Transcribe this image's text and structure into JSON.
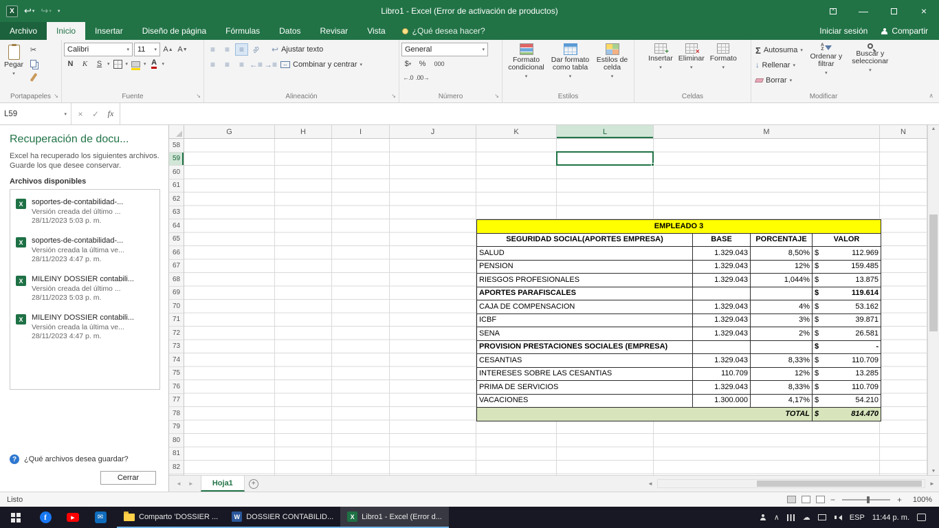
{
  "titlebar": {
    "title": "Libro1 - Excel (Error de activación de productos)"
  },
  "ribbon": {
    "tabs": [
      {
        "label": "Archivo",
        "active": false,
        "file": true
      },
      {
        "label": "Inicio",
        "active": true
      },
      {
        "label": "Insertar"
      },
      {
        "label": "Diseño de página"
      },
      {
        "label": "Fórmulas"
      },
      {
        "label": "Datos"
      },
      {
        "label": "Revisar"
      },
      {
        "label": "Vista"
      }
    ],
    "tell_me": "¿Qué desea hacer?",
    "sign_in": "Iniciar sesión",
    "share": "Compartir",
    "clipboard": {
      "label": "Portapapeles",
      "paste": "Pegar"
    },
    "font": {
      "label": "Fuente",
      "name": "Calibri",
      "size": "11",
      "bold": "N",
      "italic": "K",
      "underline": "S"
    },
    "alignment": {
      "label": "Alineación",
      "wrap": "Ajustar texto",
      "merge": "Combinar y centrar"
    },
    "number": {
      "label": "Número",
      "format": "General",
      "currency": "$",
      "percent": "%",
      "thousands": "000",
      "inc_dec": "←.0",
      "dec_dec": ".00→"
    },
    "styles": {
      "label": "Estilos",
      "conditional": "Formato condicional",
      "as_table": "Dar formato como tabla",
      "cell_styles": "Estilos de celda"
    },
    "cells": {
      "label": "Celdas",
      "insert": "Insertar",
      "delete": "Eliminar",
      "format": "Formato"
    },
    "editing": {
      "label": "Modificar",
      "autosum": "Autosuma",
      "fill": "Rellenar",
      "clear": "Borrar",
      "sort": "Ordenar y filtrar",
      "find": "Buscar y seleccionar"
    }
  },
  "formula_bar": {
    "name_box": "L59",
    "formula": ""
  },
  "recovery": {
    "title": "Recuperación de docu...",
    "description": "Excel ha recuperado los siguientes archivos. Guarde los que desee conservar.",
    "available": "Archivos disponibles",
    "files": [
      {
        "name": "soportes-de-contabilidad-...",
        "version": "Versión creada del último ...",
        "date": "28/11/2023 5:03 p. m."
      },
      {
        "name": "soportes-de-contabilidad-...",
        "version": "Versión creada la última ve...",
        "date": "28/11/2023 4:47 p. m."
      },
      {
        "name": "MILEINY DOSSIER contabili...",
        "version": "Versión creada del último ...",
        "date": "28/11/2023 5:03 p. m."
      },
      {
        "name": "MILEINY DOSSIER contabili...",
        "version": "Versión creada la última ve...",
        "date": "28/11/2023 4:47 p. m."
      }
    ],
    "question": "¿Qué archivos desea guardar?",
    "close": "Cerrar"
  },
  "sheet": {
    "columns": [
      "G",
      "H",
      "I",
      "J",
      "K",
      "L",
      "M",
      "N"
    ],
    "selected_column": "L",
    "row_numbers": [
      58,
      59,
      60,
      61,
      62,
      63,
      64,
      65,
      66,
      67,
      68,
      69,
      70,
      71,
      72,
      73,
      74,
      75,
      76,
      77,
      78,
      79,
      80,
      81,
      82
    ],
    "selected_row": 59,
    "table": {
      "title": "EMPLEADO 3",
      "headers": [
        "SEGURIDAD SOCIAL(APORTES EMPRESA)",
        "BASE",
        "PORCENTAJE",
        "VALOR"
      ],
      "rows": [
        {
          "label": "SALUD",
          "base": "1.329.043",
          "pct": "8,50%",
          "cur": "$",
          "val": "112.969",
          "bold": false
        },
        {
          "label": "PENSION",
          "base": "1.329.043",
          "pct": "12%",
          "cur": "$",
          "val": "159.485",
          "bold": false
        },
        {
          "label": "RIESGOS PROFESIONALES",
          "base": "1.329.043",
          "pct": "1,044%",
          "cur": "$",
          "val": "13.875",
          "bold": false
        },
        {
          "label": "APORTES PARAFISCALES",
          "base": "",
          "pct": "",
          "cur": "$",
          "val": "119.614",
          "bold": true
        },
        {
          "label": "CAJA DE COMPENSACION",
          "base": "1.329.043",
          "pct": "4%",
          "cur": "$",
          "val": "53.162",
          "bold": false
        },
        {
          "label": "ICBF",
          "base": "1.329.043",
          "pct": "3%",
          "cur": "$",
          "val": "39.871",
          "bold": false
        },
        {
          "label": "SENA",
          "base": "1.329.043",
          "pct": "2%",
          "cur": "$",
          "val": "26.581",
          "bold": false
        },
        {
          "label": "PROVISION PRESTACIONES SOCIALES (EMPRESA)",
          "base": "",
          "pct": "",
          "cur": "$",
          "val": "-",
          "bold": true
        },
        {
          "label": "CESANTIAS",
          "base": "1.329.043",
          "pct": "8,33%",
          "cur": "$",
          "val": "110.709",
          "bold": false
        },
        {
          "label": "INTERESES SOBRE LAS CESANTIAS",
          "base": "110.709",
          "pct": "12%",
          "cur": "$",
          "val": "13.285",
          "bold": false
        },
        {
          "label": "PRIMA DE SERVICIOS",
          "base": "1.329.043",
          "pct": "8,33%",
          "cur": "$",
          "val": "110.709",
          "bold": false
        },
        {
          "label": "VACACIONES",
          "base": "1.300.000",
          "pct": "4,17%",
          "cur": "$",
          "val": "54.210",
          "bold": false
        }
      ],
      "total": {
        "label": "TOTAL",
        "cur": "$",
        "val": "814.470"
      }
    }
  },
  "sheet_tabs": {
    "active": "Hoja1"
  },
  "status": {
    "ready": "Listo",
    "zoom": "100%"
  },
  "taskbar": {
    "apps": [
      {
        "label": "Comparto 'DOSSIER ...",
        "icon": "folder",
        "active": false
      },
      {
        "label": "DOSSIER CONTABILID...",
        "icon": "word",
        "active": false
      },
      {
        "label": "Libro1 - Excel (Error d...",
        "icon": "excel",
        "active": true
      }
    ],
    "language": "ESP",
    "time": "11:44 p. m."
  }
}
